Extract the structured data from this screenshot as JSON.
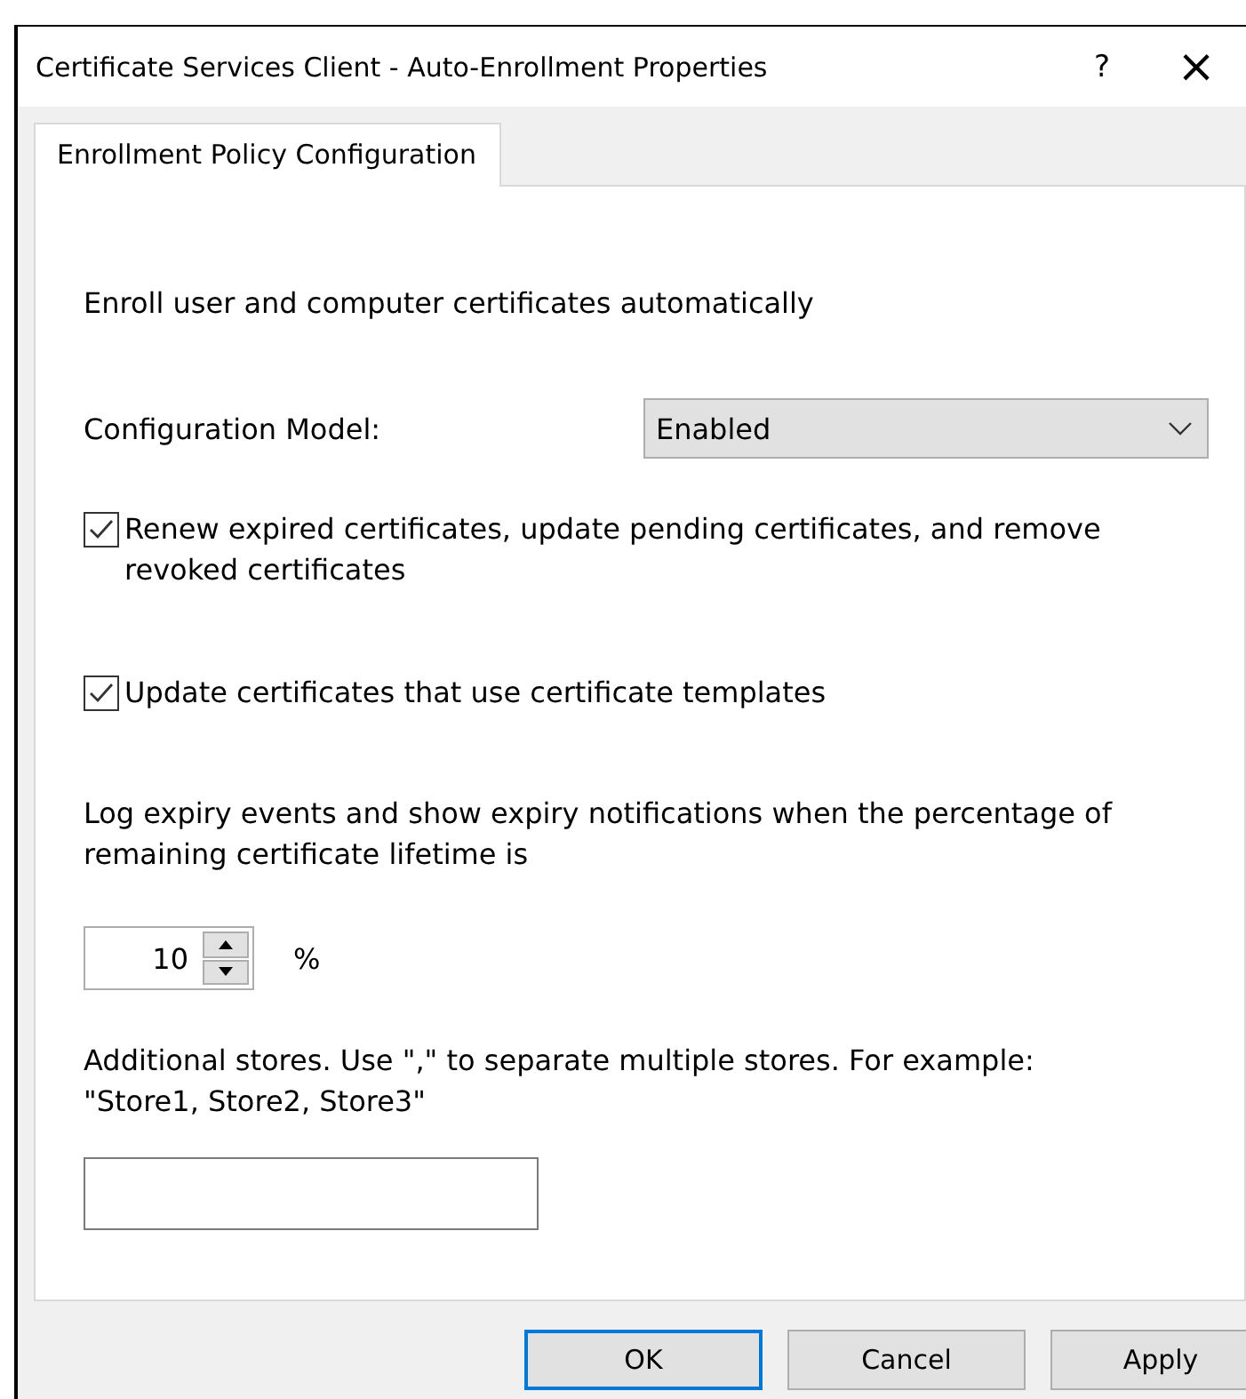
{
  "window": {
    "title": "Certificate Services Client - Auto-Enrollment Properties",
    "help": "?",
    "close": "×"
  },
  "tabs": [
    {
      "label": "Enrollment Policy Configuration",
      "selected": true
    }
  ],
  "intro": "Enroll user and computer certificates automatically",
  "configuration_model": {
    "label": "Configuration Model:",
    "value": "Enabled"
  },
  "options": [
    {
      "label": "Renew expired certificates, update pending certificates, and remove revoked certificates",
      "checked": true
    },
    {
      "label": "Update certificates that use certificate templates",
      "checked": true
    }
  ],
  "expiry": {
    "text": "Log expiry events and show expiry notifications when the percentage of remaining certificate lifetime is",
    "value": "10",
    "unit": "%"
  },
  "stores": {
    "text": "Additional stores. Use \",\" to separate multiple stores. For example: \"Store1, Store2, Store3\""
  },
  "buttons": [
    {
      "label": "OK",
      "default": true
    },
    {
      "label": "Cancel",
      "default": false
    },
    {
      "label": "Apply",
      "default": false
    }
  ]
}
